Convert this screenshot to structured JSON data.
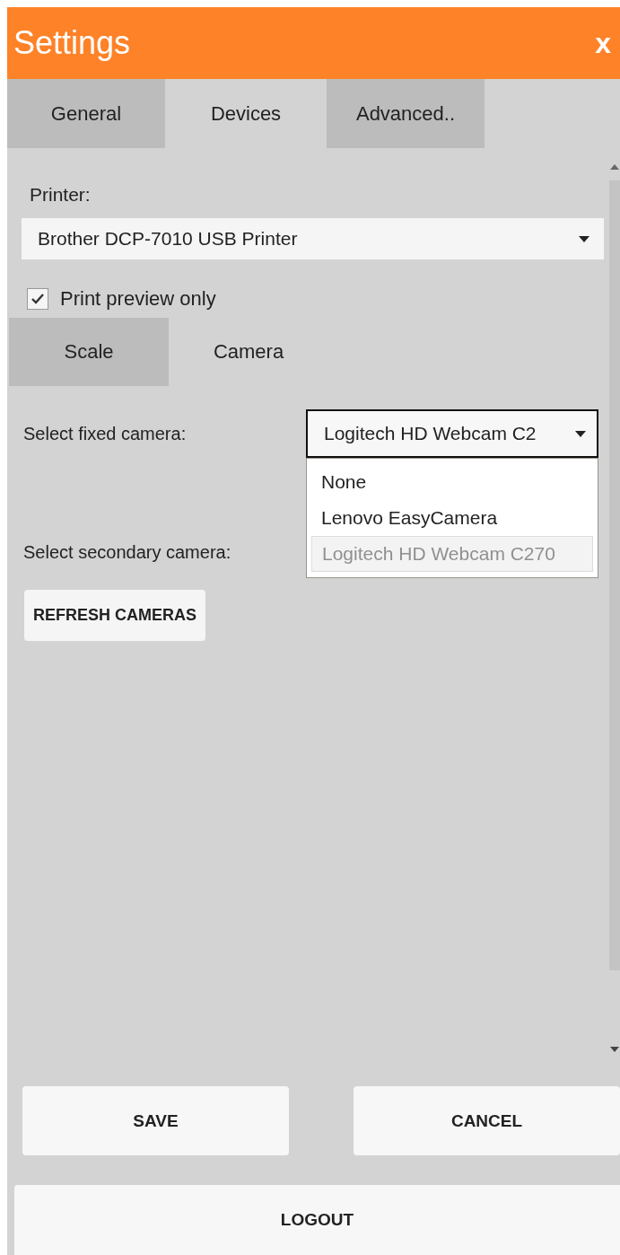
{
  "window": {
    "title": "Settings",
    "close": "x"
  },
  "tabs": [
    {
      "label": "General",
      "selected": false
    },
    {
      "label": "Devices",
      "selected": true
    },
    {
      "label": "Advanced..",
      "selected": false
    }
  ],
  "printer": {
    "label": "Printer:",
    "value": "Brother DCP-7010 USB Printer"
  },
  "print_preview": {
    "label": "Print preview only",
    "checked": true
  },
  "subtabs": [
    {
      "label": "Scale",
      "selected": false
    },
    {
      "label": "Camera",
      "selected": true
    }
  ],
  "fixed_camera": {
    "label": "Select fixed camera:",
    "value": "Logitech HD Webcam C2",
    "expanded": true,
    "options": [
      {
        "label": "None",
        "selected": false
      },
      {
        "label": "Lenovo EasyCamera",
        "selected": false
      },
      {
        "label": "Logitech HD Webcam C270",
        "selected": true
      }
    ]
  },
  "secondary_camera": {
    "label": "Select secondary camera:"
  },
  "refresh_button": "REFRESH CAMERAS",
  "buttons": [
    "SAVE",
    "CANCEL"
  ],
  "logout_button": "LOGOUT"
}
